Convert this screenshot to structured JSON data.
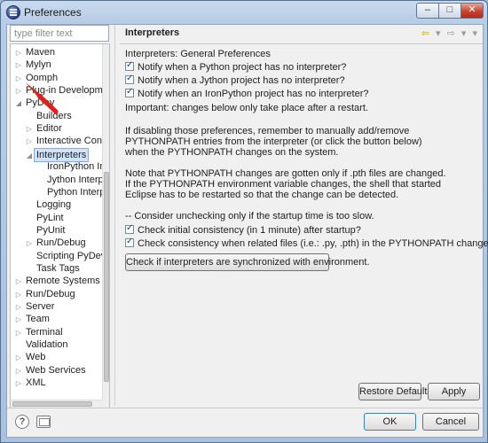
{
  "window": {
    "title": "Preferences",
    "controls": {
      "minimize": "–",
      "maximize": "□",
      "close": "✕"
    }
  },
  "filter": {
    "placeholder": "type filter text",
    "value": ""
  },
  "tree": {
    "items": [
      {
        "label": "Maven",
        "level": 0,
        "expander": "collapsed"
      },
      {
        "label": "Mylyn",
        "level": 0,
        "expander": "collapsed"
      },
      {
        "label": "Oomph",
        "level": 0,
        "expander": "collapsed"
      },
      {
        "label": "Plug-in Development",
        "level": 0,
        "expander": "collapsed"
      },
      {
        "label": "PyDev",
        "level": 0,
        "expander": "expanded"
      },
      {
        "label": "Builders",
        "level": 1,
        "expander": "none"
      },
      {
        "label": "Editor",
        "level": 1,
        "expander": "collapsed"
      },
      {
        "label": "Interactive Console",
        "level": 1,
        "expander": "collapsed"
      },
      {
        "label": "Interpreters",
        "level": 1,
        "expander": "expanded",
        "selected": true
      },
      {
        "label": "IronPython Interpreter",
        "level": 2,
        "expander": "none"
      },
      {
        "label": "Jython Interpreter",
        "level": 2,
        "expander": "none"
      },
      {
        "label": "Python Interpreter",
        "level": 2,
        "expander": "none"
      },
      {
        "label": "Logging",
        "level": 1,
        "expander": "none"
      },
      {
        "label": "PyLint",
        "level": 1,
        "expander": "none"
      },
      {
        "label": "PyUnit",
        "level": 1,
        "expander": "none"
      },
      {
        "label": "Run/Debug",
        "level": 1,
        "expander": "collapsed"
      },
      {
        "label": "Scripting PyDev",
        "level": 1,
        "expander": "none"
      },
      {
        "label": "Task Tags",
        "level": 1,
        "expander": "none"
      },
      {
        "label": "Remote Systems",
        "level": 0,
        "expander": "collapsed"
      },
      {
        "label": "Run/Debug",
        "level": 0,
        "expander": "collapsed"
      },
      {
        "label": "Server",
        "level": 0,
        "expander": "collapsed"
      },
      {
        "label": "Team",
        "level": 0,
        "expander": "collapsed"
      },
      {
        "label": "Terminal",
        "level": 0,
        "expander": "collapsed"
      },
      {
        "label": "Validation",
        "level": 0,
        "expander": "none"
      },
      {
        "label": "Web",
        "level": 0,
        "expander": "collapsed"
      },
      {
        "label": "Web Services",
        "level": 0,
        "expander": "collapsed"
      },
      {
        "label": "XML",
        "level": 0,
        "expander": "collapsed"
      }
    ],
    "expander_glyphs": {
      "collapsed": "▷",
      "expanded": "◢",
      "none": ""
    }
  },
  "page": {
    "title": "Interpreters",
    "nav": {
      "back": "⇦",
      "back_menu": "▾",
      "forward": "⇨",
      "forward_menu": "▾",
      "menu": "▾"
    },
    "section_label": "Interpreters: General Preferences",
    "checks_top": [
      {
        "label": "Notify when a Python project has no interpreter?",
        "checked": true
      },
      {
        "label": "Notify when a Jython project has no interpreter?",
        "checked": true
      },
      {
        "label": "Notify when an IronPython project has no interpreter?",
        "checked": true
      }
    ],
    "important": "Important: changes below only take place after a restart.",
    "para1": [
      "If disabling those preferences, remember to manually add/remove",
      "PYTHONPATH entries from the interpreter (or click the button below)",
      "when the PYTHONPATH changes on the system."
    ],
    "para2": [
      "Note that PYTHONPATH changes are gotten only if .pth files are changed.",
      "If the PYTHONPATH environment variable changes, the shell that started",
      "Eclipse has to be restarted so that the change can be detected."
    ],
    "startup_note": "-- Consider unchecking only if the startup time is too slow.",
    "checks_bottom": [
      {
        "label": "Check initial consistency (in 1 minute) after startup?",
        "checked": true
      },
      {
        "label": "Check consistency when related files (i.e.: .py, .pth) in the PYTHONPATH change?",
        "checked": true
      }
    ],
    "sync_button": "Check if interpreters are synchronized with environment.",
    "restore_defaults": "Restore Defaults",
    "apply": "Apply"
  },
  "footer": {
    "help_glyph": "?",
    "ok": "OK",
    "cancel": "Cancel"
  }
}
